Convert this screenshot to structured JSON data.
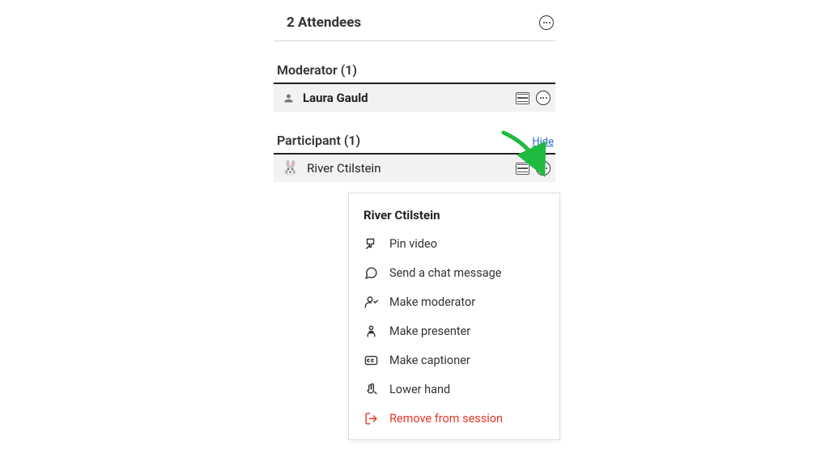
{
  "header": {
    "title": "2 Attendees"
  },
  "sections": {
    "moderator": {
      "title": "Moderator (1)",
      "rows": [
        {
          "name": "Laura Gauld"
        }
      ]
    },
    "participant": {
      "title": "Participant (1)",
      "hide_label": "Hide",
      "rows": [
        {
          "name": "River Ctilstein"
        }
      ]
    }
  },
  "menu": {
    "header": "River Ctilstein",
    "items": {
      "pin": "Pin video",
      "chat": "Send a chat message",
      "moderator": "Make moderator",
      "presenter": "Make presenter",
      "captioner": "Make captioner",
      "lower_hand": "Lower hand",
      "remove": "Remove from session"
    }
  },
  "colors": {
    "danger": "#e8382b",
    "link": "#2e6bc5",
    "arrow": "#1fba3f"
  }
}
